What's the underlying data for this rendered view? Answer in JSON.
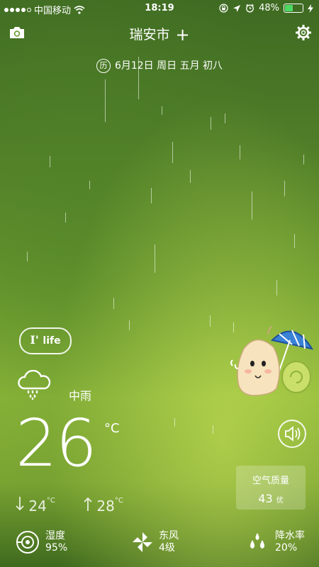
{
  "status": {
    "carrier": "中国移动",
    "time": "18:19",
    "battery": "48%",
    "battery_level": 0.48
  },
  "header": {
    "city": "瑞安市",
    "add_label": "+"
  },
  "date": {
    "badge": "历",
    "text": "6月12日 周日  五月 初八"
  },
  "ilife": {
    "big": "I'",
    "small": "life"
  },
  "weather": {
    "condition": "中雨",
    "temperature": "26",
    "unit": "°C",
    "low": "24",
    "high": "28",
    "deg": "°C"
  },
  "air_quality": {
    "title": "空气质量",
    "value": "43",
    "level": "优"
  },
  "stats": [
    {
      "label": "湿度",
      "value": "95%",
      "icon": "humidity-icon"
    },
    {
      "label": "东风",
      "value": "4级",
      "icon": "wind-icon"
    },
    {
      "label": "降水率",
      "value": "20%",
      "icon": "rain-drops-icon"
    }
  ],
  "colors": {
    "battery": "#4cd964",
    "accent": "#ffffff"
  }
}
